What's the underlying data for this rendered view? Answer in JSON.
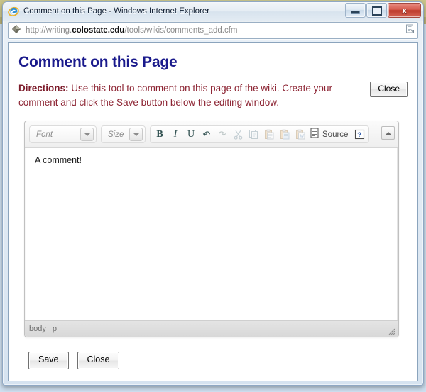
{
  "window": {
    "title": "Comment on this Page - Windows Internet Explorer",
    "app_icon": "internet-explorer-icon",
    "controls": {
      "minimize": "minimize-icon",
      "maximize": "maximize-icon",
      "close": "x"
    }
  },
  "address_bar": {
    "icon": "favicon-diamond-icon",
    "url_prefix": "http://writing.",
    "url_domain": "colostate.edu",
    "url_suffix": "/tools/wikis/comments_add.cfm",
    "right_icon": "page-feed-icon"
  },
  "page": {
    "title": "Comment on this Page",
    "directions_label": "Directions:",
    "directions_text": " Use this tool to comment on this page of the wiki. Create your comment and click the Save button below the editing window.",
    "close_top_label": "Close"
  },
  "editor": {
    "font_combo": {
      "label": "Font",
      "icon": "chevron-down-icon"
    },
    "size_combo": {
      "label": "Size",
      "icon": "chevron-down-icon"
    },
    "buttons": [
      {
        "name": "bold-button",
        "glyph": "B",
        "style": "bold",
        "disabled": false
      },
      {
        "name": "italic-button",
        "glyph": "I",
        "style": "ital",
        "disabled": false
      },
      {
        "name": "underline-button",
        "glyph": "U",
        "style": "under",
        "disabled": false
      },
      {
        "name": "undo-button",
        "glyph": "↶",
        "style": "arrow",
        "disabled": false
      },
      {
        "name": "redo-button",
        "glyph": "↷",
        "style": "arrow",
        "disabled": true
      }
    ],
    "clipboard_buttons": [
      {
        "name": "cut-button",
        "icon": "scissors-icon",
        "disabled": true
      },
      {
        "name": "copy-button",
        "icon": "copy-icon",
        "disabled": true
      },
      {
        "name": "paste-button",
        "icon": "paste-icon",
        "disabled": true
      },
      {
        "name": "paste-plain-text-button",
        "icon": "paste-text-icon",
        "disabled": true
      },
      {
        "name": "paste-from-word-button",
        "icon": "paste-word-icon",
        "disabled": true
      }
    ],
    "source_label": "Source",
    "source_icon": "source-document-icon",
    "help_label": "?",
    "help_icon": "help-icon",
    "collapse_icon": "chevron-up-icon",
    "content": "A comment!",
    "elements_path": [
      "body",
      "p"
    ],
    "resize_handle": "resize-grip-icon"
  },
  "footer": {
    "save_label": "Save",
    "close_label": "Close"
  },
  "colors": {
    "heading": "#1a1a8c",
    "directions": "#8c2332",
    "titlebar_close": "#bc3b2c",
    "editor_bg": "#f7f7f7"
  }
}
